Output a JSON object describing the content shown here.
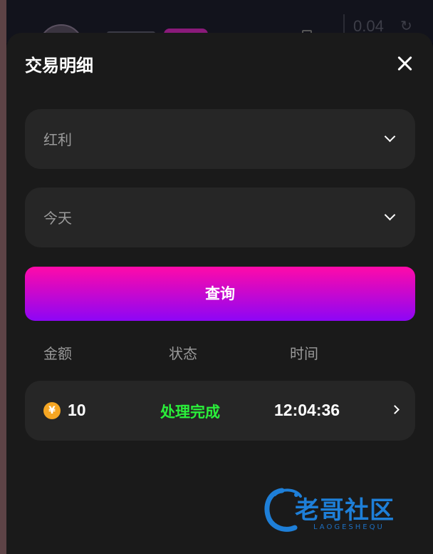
{
  "modal": {
    "title": "交易明细"
  },
  "filters": {
    "type_value": "红利",
    "date_value": "今天"
  },
  "query_label": "查询",
  "table": {
    "headers": [
      "金额",
      "状态",
      "时间"
    ],
    "rows": [
      {
        "coin_symbol": "¥",
        "amount": "10",
        "status": "处理完成",
        "time": "12:04:36"
      }
    ]
  },
  "background": {
    "balance": "0.04"
  },
  "watermark": {
    "text": "老哥社区",
    "sub": "LAOGESHEQU"
  },
  "colors": {
    "accent_top": "#ff0aa8",
    "accent_bottom": "#8d06f6",
    "status_success": "#2aef3a",
    "coin": "#f5a623"
  },
  "icons": {
    "close": "close-icon",
    "select_arrow": "chevron-down-icon",
    "row_arrow": "chevron-right-icon",
    "coin": "yuan-coin-icon"
  }
}
